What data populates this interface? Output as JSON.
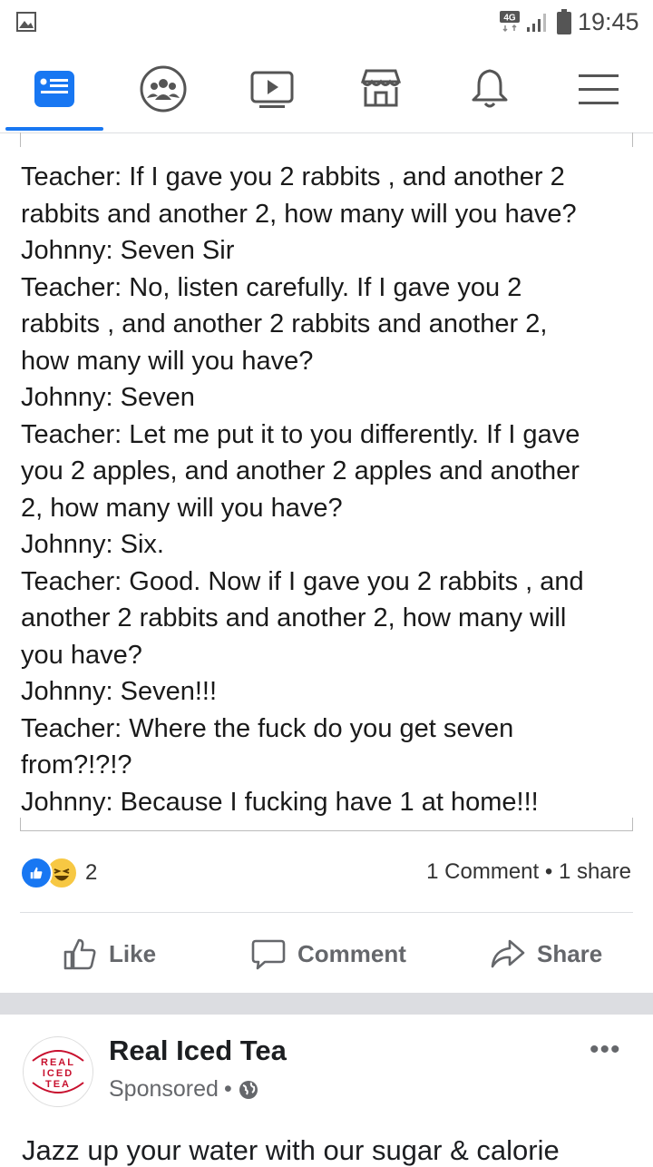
{
  "status_bar": {
    "network": "4G",
    "time": "19:45"
  },
  "nav": {
    "tabs": [
      "news-feed-icon",
      "groups-icon",
      "watch-icon",
      "marketplace-icon",
      "notifications-icon",
      "menu-icon"
    ],
    "active_color": "#1877f2"
  },
  "post": {
    "text_lines": [
      "Teacher: If I gave you 2 rabbits , and another 2",
      "rabbits and another 2, how many will you have?",
      "Johnny: Seven Sir",
      "Teacher: No, listen carefully. If I gave you 2",
      "rabbits , and another 2 rabbits and another 2,",
      "how many will you have?",
      "Johnny: Seven",
      "Teacher: Let me put it to you differently. If I gave",
      "you 2 apples, and another 2 apples and another",
      "2, how many will you have?",
      "Johnny: Six.",
      "Teacher: Good. Now if I gave you 2 rabbits , and",
      "another 2 rabbits and another 2, how many will",
      "you have?",
      "Johnny: Seven!!!",
      "Teacher: Where the fuck do you get seven",
      "from?!?!?",
      "Johnny: Because I fucking have 1 at home!!!"
    ],
    "reaction_count": "2",
    "stats": "1 Comment • 1 share",
    "actions": {
      "like": "Like",
      "comment": "Comment",
      "share": "Share"
    }
  },
  "sponsored": {
    "logo_lines": [
      "REAL",
      "ICED",
      "TEA"
    ],
    "name": "Real Iced Tea",
    "meta": "Sponsored",
    "more": "•••",
    "text": "Jazz up your water with our sugar & calorie"
  }
}
